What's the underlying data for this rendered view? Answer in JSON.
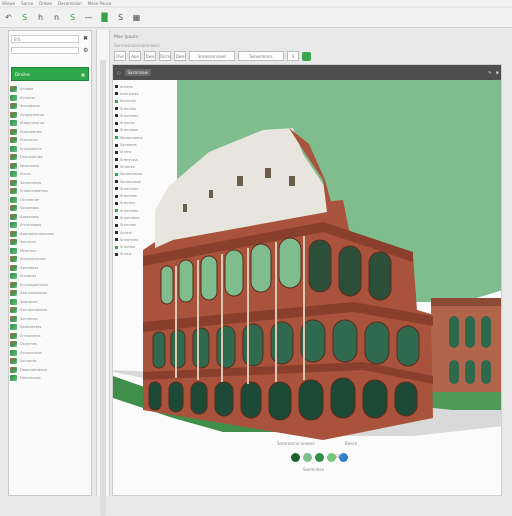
{
  "menubar": {
    "items": [
      "Wiewe",
      "Sanse",
      "Dnkee",
      "Desarresion",
      "Mese Pause"
    ]
  },
  "toolbar": {
    "icons": [
      "back-icon",
      "s-icon",
      "h-icon",
      "n-icon",
      "s-icon",
      "dash-icon",
      "chart-icon",
      "s-icon",
      "grid-icon"
    ]
  },
  "left_panel": {
    "search_placeholder": "B'S",
    "green_button_label": "Dimiles",
    "items": [
      "Anirate",
      "Scrmnss",
      "Snnsoterss",
      "Sinsesnennss",
      "Staonnmonss",
      "Snsiomenes",
      "Srosnmes",
      "Srsinsimens",
      "Dssnnsernes",
      "Mnsmnnss",
      "Snnns",
      "Socsenenss",
      "Srroonnseamss",
      "Ocrromner",
      "Socsenoss",
      "Bossenoss",
      "Srrrsnnsoes",
      "Sosmonsnmnomes",
      "Ssmnsns",
      "Mnsmms",
      "Snonsonsnoss",
      "Ssnmeoss",
      "Snmonss",
      "Snnseseommss",
      "Sosnnnsosoass",
      "Sosmmse",
      "Ssnnenmennss",
      "Ssmmnes",
      "Sooeneeses",
      "Srrrosnmes",
      "Dsnnmes",
      "Scronnmnss",
      "Ssrnones",
      "Doonnmmenes",
      "Dmnmnoes"
    ]
  },
  "header": {
    "line1": "Mos Ipauln",
    "line2": "Serrnnsnaanaamnaess",
    "fields": [
      "Dvs",
      "Aoe",
      "Dwe",
      "Dicre",
      "Dwe",
      "Snrensnnnaes",
      "Sonesmnns",
      "S"
    ]
  },
  "content": {
    "bar_label": "Sasnnnaw",
    "items": [
      "Arrtess",
      "Armrnares",
      "Sminrres",
      "Srmnnes",
      "Srnnnmes",
      "Srnnnes",
      "Srmnnass",
      "Sanmnnenss",
      "Sannmes",
      "Srnms",
      "Srmnnnss",
      "Smmres",
      "Sanmmenss",
      "Sanmnonss",
      "Srnmnnes",
      "Srmmnss",
      "Srmrnes",
      "Srnnmees",
      "Srnnmmes",
      "Srnmnes",
      "Smrne",
      "Srnnmnes",
      "Srmmes",
      "Srnme"
    ],
    "caption_left": "Srearessnn oneess",
    "caption_right": "Beece",
    "pager_label": "SVE",
    "caption_bottom": "Soemnhes"
  },
  "colors": {
    "accent_green": "#2ea84a",
    "sky_green": "#7fbd8f",
    "stone": "#a9533c",
    "dark_bar": "#4e4e4e"
  },
  "pager_dots": [
    "#1f5f2f",
    "#7fbd8f",
    "#2d8e44",
    "#77c77a",
    "#2f7fd0"
  ]
}
